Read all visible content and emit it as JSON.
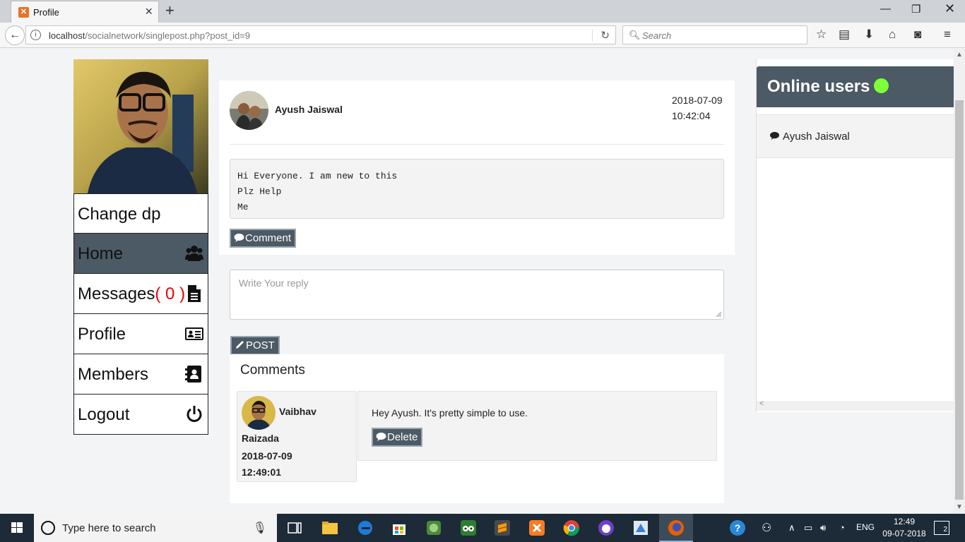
{
  "browser": {
    "tab_title": "Profile",
    "url_host": "localhost",
    "url_path": "/socialnetwork/singlepost.php?post_id=9",
    "search_placeholder": "Search"
  },
  "sidebar": {
    "items": [
      {
        "label": "Change dp"
      },
      {
        "label": "Home",
        "icon": "users-icon"
      },
      {
        "label": "Messages",
        "count": "( 0 )",
        "icon": "document-icon"
      },
      {
        "label": "Profile",
        "icon": "id-card-icon"
      },
      {
        "label": "Members",
        "icon": "address-book-icon"
      },
      {
        "label": "Logout",
        "icon": "power-icon"
      }
    ]
  },
  "post": {
    "author": "Ayush Jaiswal",
    "date": "2018-07-09",
    "time": "10:42:04",
    "body": "Hi Everyone. I am new to this\nPlz Help\nMe",
    "comment_button": "Comment"
  },
  "reply": {
    "placeholder": "Write Your reply",
    "post_button": "POST"
  },
  "comments": {
    "heading": "Comments",
    "items": [
      {
        "first_name": "Vaibhav",
        "last_name": "Raizada",
        "date": "2018-07-09",
        "time": "12:49:01",
        "text": "Hey Ayush. It's pretty simple to use.",
        "delete_button": "Delete"
      }
    ]
  },
  "online_users": {
    "title": "Online users",
    "users": [
      "Ayush Jaiswal"
    ]
  },
  "taskbar": {
    "search_text": "Type here to search",
    "language": "ENG",
    "time": "12:49",
    "date": "09-07-2018",
    "notifications": "2"
  },
  "colors": {
    "accent": "#4b5a64",
    "online_dot": "#7dff3a",
    "message_count": "#ee0000"
  }
}
